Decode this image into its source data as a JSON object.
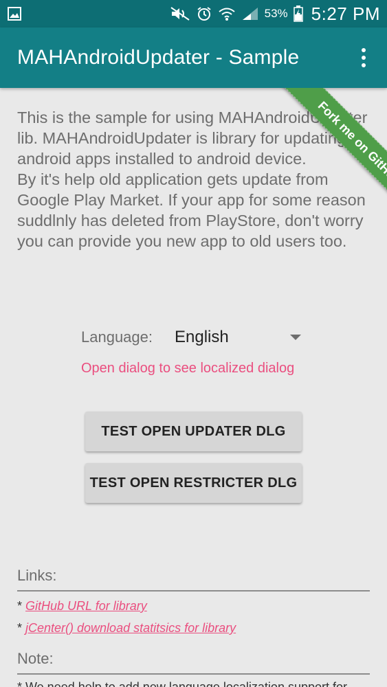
{
  "status_bar": {
    "battery_percent": "53%",
    "time": "5:27 PM",
    "icons": [
      "gallery-icon",
      "mute-icon",
      "alarm-icon",
      "wifi-icon",
      "signal-icon",
      "battery-charging-icon"
    ]
  },
  "app_bar": {
    "title": "MAHAndroidUpdater - Sample",
    "overflow_icon": "more-vert-icon"
  },
  "ribbon": {
    "label": "Fork me on GitHub",
    "color": "#4f9e49"
  },
  "intro": {
    "paragraph1": "This is the sample for using MAHAndroidUpdater lib. MAHAndroidUpdater is library for updating android apps installed to android device.",
    "paragraph2": "By it's help old application gets update from Google Play Market. If your app for some reason suddlnly has deleted from PlayStore, don't worry you can provide you new app to old users too."
  },
  "language": {
    "label": "Language:",
    "selected": "English",
    "hint": "Open dialog to see localized dialog"
  },
  "buttons": {
    "updater": "TEST OPEN UPDATER DLG",
    "restricter": "TEST OPEN RESTRICTER DLG"
  },
  "links": {
    "heading": "Links:",
    "bullet": "*",
    "items": [
      "GitHub URL for library",
      "jCenter() download statitsics for library"
    ]
  },
  "note": {
    "heading": "Note:",
    "text": "* We need help to add new language localization support for"
  },
  "colors": {
    "status_bar": "#0d6e74",
    "app_bar": "#137f86",
    "accent": "#ea4e7f",
    "background": "#e9e9e9"
  }
}
